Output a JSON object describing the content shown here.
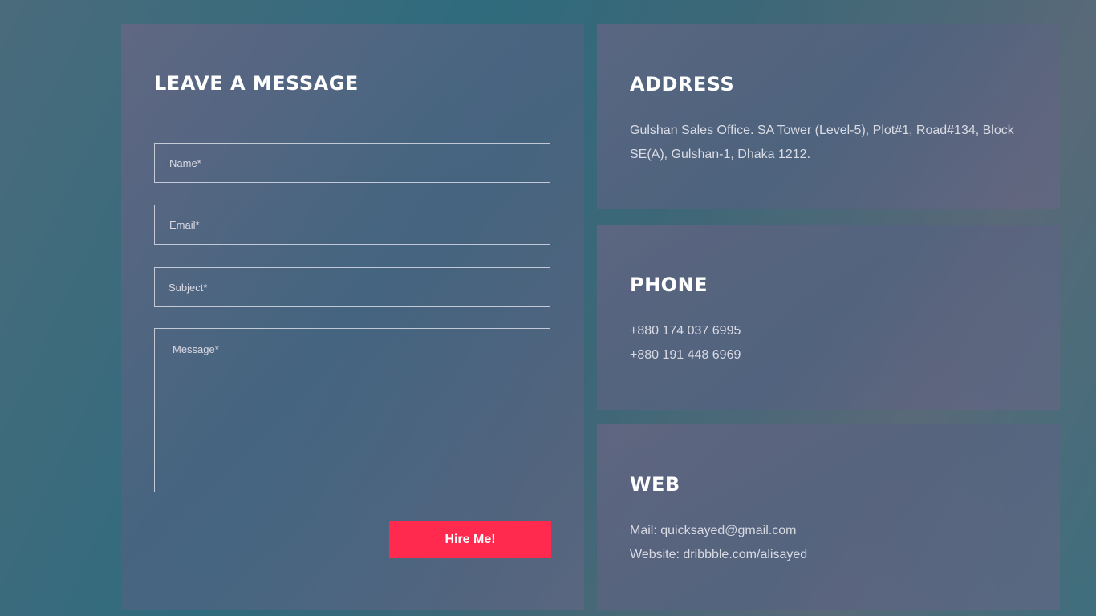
{
  "contact_form": {
    "title": "LEAVE A MESSAGE",
    "name_placeholder": "Name*",
    "email_placeholder": "Email*",
    "subject_placeholder": "Subject*",
    "message_placeholder": "Message*",
    "submit_label": "Hire Me!"
  },
  "address": {
    "title": "ADDRESS",
    "text": "Gulshan Sales Office. SA Tower (Level-5), Plot#1, Road#134, Block SE(A), Gulshan-1, Dhaka 1212."
  },
  "phone": {
    "title": "PHONE",
    "numbers": [
      "+880 174 037 6995",
      "+880 191 448 6969"
    ]
  },
  "web": {
    "title": "WEB",
    "mail": "Mail: quicksayed@gmail.com",
    "website": "Website: dribbble.com/alisayed"
  },
  "colors": {
    "accent": "#ff2a4d",
    "heading_text": "#ffffff",
    "body_text": "#d9dbe4"
  }
}
